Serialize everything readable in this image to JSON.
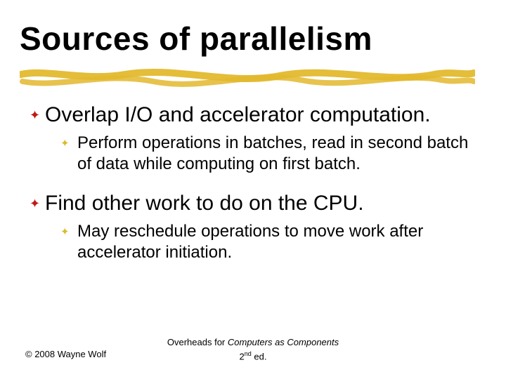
{
  "title": "Sources of parallelism",
  "bullets": {
    "b1": {
      "text": "Overlap I/O and accelerator computation.",
      "sub": "Perform operations in batches, read in second batch of data while computing on first batch."
    },
    "b2": {
      "text": "Find other work to do on the CPU.",
      "sub": "May reschedule operations to move work after accelerator initiation."
    }
  },
  "footer": {
    "copyright": "© 2008 Wayne Wolf",
    "center_prefix": "Overheads for ",
    "center_book": "Computers as Components",
    "center_edition": " 2",
    "center_suffix": " ed."
  },
  "glyphs": {
    "l1_bullet": "✦",
    "l2_bullet": "✦"
  },
  "colors": {
    "accent_red": "#c01818",
    "accent_gold": "#d9bc2b",
    "stroke_gold": "#e3b92e"
  }
}
